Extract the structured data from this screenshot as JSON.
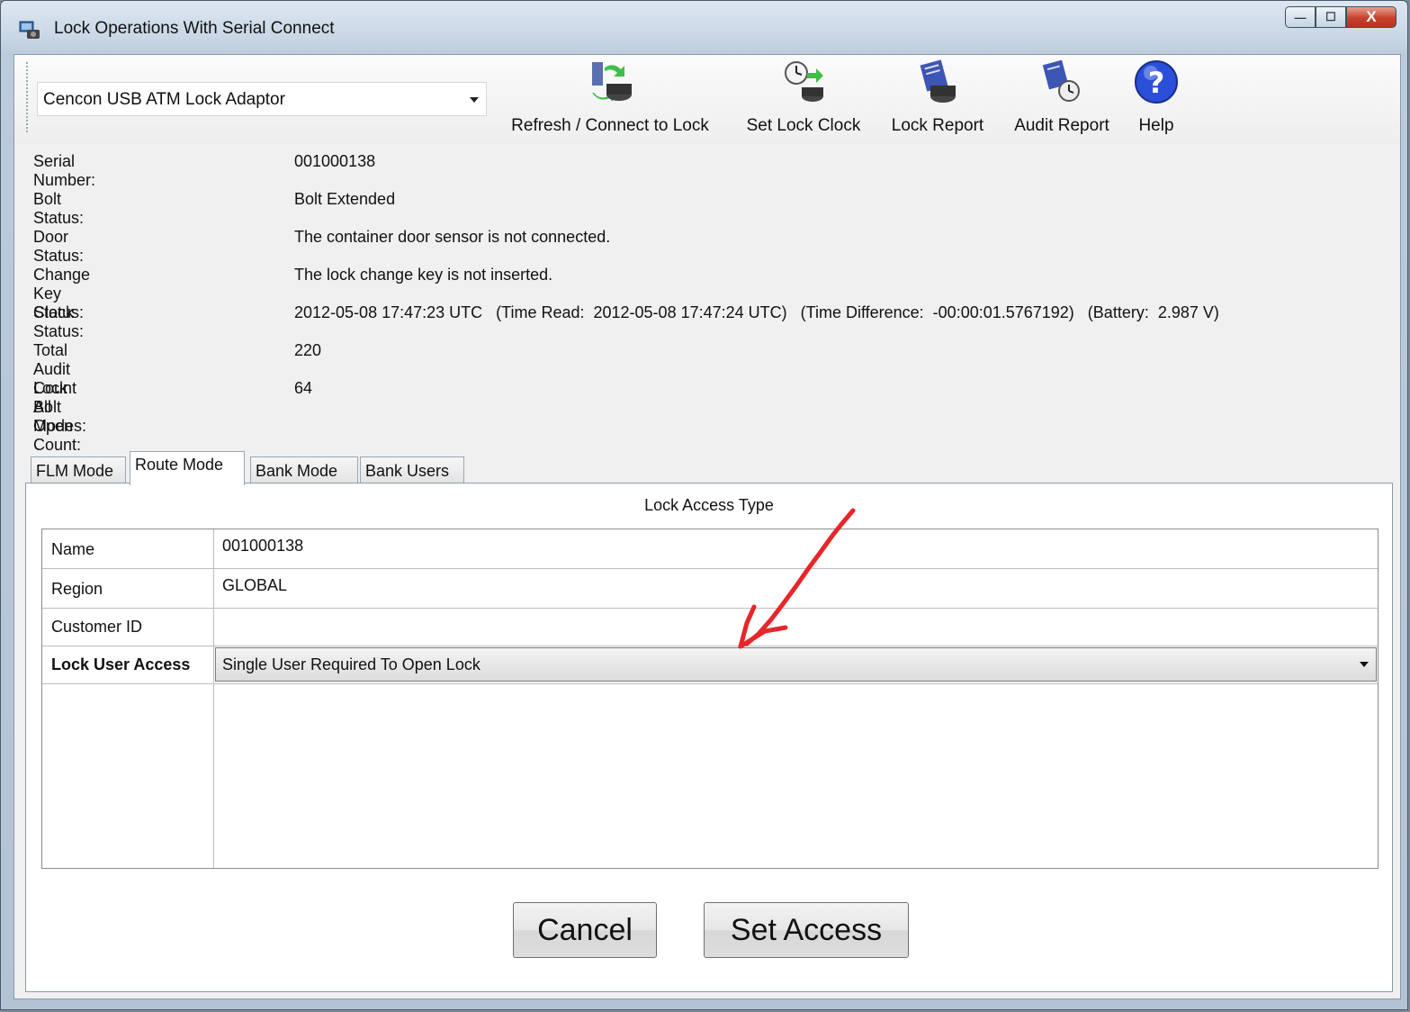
{
  "window": {
    "title": "Lock Operations With Serial Connect",
    "controls": {
      "minimize": "—",
      "maximize": "☐",
      "close": "X"
    }
  },
  "toolbar": {
    "adapter": {
      "selected": "Cencon USB ATM Lock Adaptor"
    },
    "buttons": [
      {
        "label": "Refresh / Connect to Lock",
        "icon": "refresh-connect-icon"
      },
      {
        "label": "Set Lock Clock",
        "icon": "clock-lock-icon"
      },
      {
        "label": "Lock Report",
        "icon": "report-lock-icon"
      },
      {
        "label": "Audit Report",
        "icon": "audit-report-icon"
      },
      {
        "label": "Help",
        "icon": "help-icon"
      }
    ]
  },
  "info": [
    {
      "label": "Serial Number:",
      "value": "001000138"
    },
    {
      "label": "Bolt Status:",
      "value": "Bolt Extended"
    },
    {
      "label": "Door Status:",
      "value": "The container door sensor is not connected."
    },
    {
      "label": "Change Key Status:",
      "value": "The lock change key is not inserted."
    },
    {
      "label": "Clock Status:",
      "value": "2012-05-08 17:47:23 UTC   (Time Read:  2012-05-08 17:47:24 UTC)   (Time Difference:  -00:00:01.5767192)   (Battery:  2.987 V)"
    },
    {
      "label": "Total Audit Count All Modes:",
      "value": "220"
    },
    {
      "label": "Lock Bolt Open Count:",
      "value": "64"
    }
  ],
  "tabs": [
    {
      "label": "FLM Mode",
      "active": false
    },
    {
      "label": "Route Mode",
      "active": true
    },
    {
      "label": "Bank Mode",
      "active": false
    },
    {
      "label": "Bank Users",
      "active": false
    }
  ],
  "panel": {
    "title": "Lock Access Type",
    "rows": [
      {
        "label": "Name",
        "value": "001000138"
      },
      {
        "label": "Region",
        "value": "GLOBAL"
      },
      {
        "label": "Customer ID",
        "value": ""
      },
      {
        "label": "Lock User Access",
        "value": "Single User Required To Open Lock"
      }
    ]
  },
  "buttons": {
    "cancel": "Cancel",
    "set_access": "Set Access"
  },
  "colors": {
    "annotation_arrow": "#e8262a",
    "help_icon": "#2b4fd8"
  }
}
